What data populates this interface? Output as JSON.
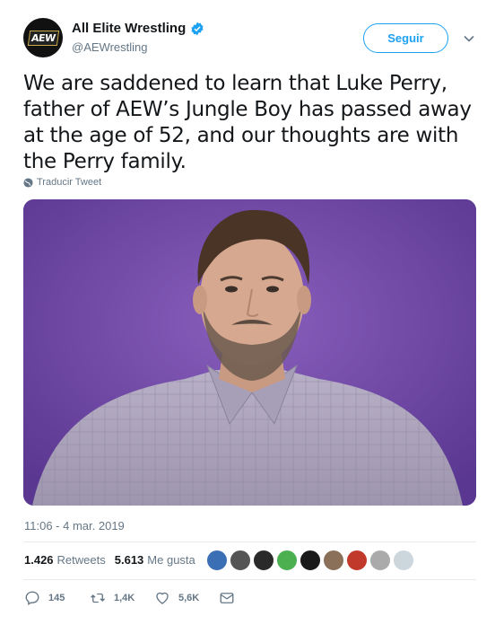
{
  "account": {
    "display_name": "All Elite Wrestling",
    "handle": "@AEWrestling",
    "avatar_text": "AEW",
    "verified": true
  },
  "follow_button": {
    "label": "Seguir"
  },
  "tweet": {
    "text": "We are saddened to learn that Luke Perry, father of AEW’s Jungle Boy has passed away at the age of 52, and our thoughts are with the Perry family.",
    "translate_label": "Traducir Tweet",
    "timestamp": "11:06 - 4 mar. 2019"
  },
  "stats": {
    "retweets_count": "1.426",
    "retweets_label": "Retweets",
    "likes_count": "5.613",
    "likes_label": "Me gusta"
  },
  "actions": {
    "reply_count": "145",
    "retweet_count": "1,4K",
    "like_count": "5,6K"
  },
  "colors": {
    "accent": "#1da1f2",
    "media_background": "#6f4aa0",
    "muted_text": "#657786"
  },
  "icons": [
    "verified-icon",
    "chevron-down-icon",
    "globe-icon",
    "reply-icon",
    "retweet-icon",
    "heart-icon",
    "message-icon"
  ]
}
